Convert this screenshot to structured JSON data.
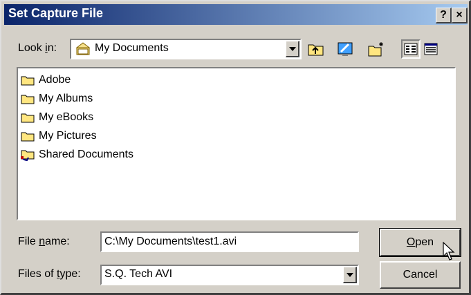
{
  "window": {
    "title": "Set Capture File",
    "help_label": "?",
    "close_label": "×"
  },
  "look_in": {
    "label_pre": "Look ",
    "label_mn": "i",
    "label_post": "n:",
    "value": "My Documents"
  },
  "toolbar": {
    "items": [
      "up-one-level",
      "desktop",
      "new-folder",
      "list-view",
      "details-view"
    ]
  },
  "file_list": {
    "items": [
      {
        "label": "Adobe",
        "icon": "folder"
      },
      {
        "label": "My Albums",
        "icon": "folder"
      },
      {
        "label": "My eBooks",
        "icon": "folder"
      },
      {
        "label": "My Pictures",
        "icon": "folder"
      },
      {
        "label": "Shared Documents",
        "icon": "shared-folder"
      }
    ]
  },
  "filename": {
    "label_pre": "File ",
    "label_mn": "n",
    "label_post": "ame:",
    "value": "C:\\My Documents\\test1.avi"
  },
  "filetype": {
    "label_pre": "Files of ",
    "label_mn": "t",
    "label_post": "ype:",
    "value": "S.Q. Tech AVI"
  },
  "buttons": {
    "open_mn": "O",
    "open_rest": "pen",
    "cancel": "Cancel"
  },
  "colors": {
    "title_start": "#0a246a",
    "title_end": "#a6caf0",
    "face": "#d4d0c8",
    "folder": "#ffe680"
  }
}
